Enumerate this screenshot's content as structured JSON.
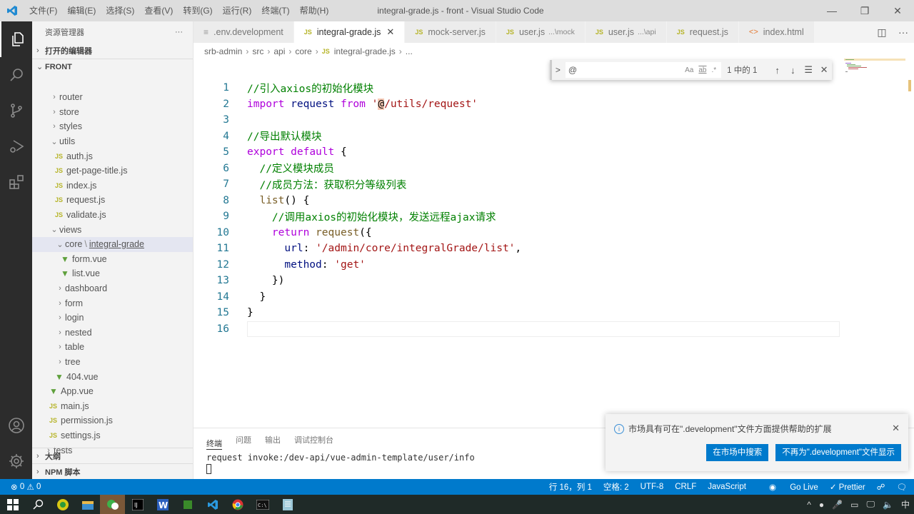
{
  "window": {
    "title": "integral-grade.js - front - Visual Studio Code",
    "menu": [
      "文件(F)",
      "编辑(E)",
      "选择(S)",
      "查看(V)",
      "转到(G)",
      "运行(R)",
      "终端(T)",
      "帮助(H)"
    ],
    "controls": {
      "minimize": "—",
      "maximize": "❐",
      "close": "✕"
    }
  },
  "activitybar": {
    "items": [
      {
        "name": "explorer",
        "icon": "files-icon",
        "active": true
      },
      {
        "name": "search",
        "icon": "search-icon"
      },
      {
        "name": "source-control",
        "icon": "source-control-icon"
      },
      {
        "name": "run-debug",
        "icon": "run-debug-icon"
      },
      {
        "name": "extensions",
        "icon": "extensions-icon"
      }
    ],
    "bottom": [
      {
        "name": "accounts",
        "icon": "account-icon"
      },
      {
        "name": "manage",
        "icon": "gear-icon"
      }
    ]
  },
  "sidebar": {
    "title": "资源管理器",
    "more": "···",
    "open_editors": "打开的编辑器",
    "folder": "FRONT",
    "tree": [
      {
        "label": "router",
        "type": "folder",
        "expanded": false,
        "depth": 2
      },
      {
        "label": "store",
        "type": "folder",
        "expanded": false,
        "depth": 2
      },
      {
        "label": "styles",
        "type": "folder",
        "expanded": false,
        "depth": 2
      },
      {
        "label": "utils",
        "type": "folder",
        "expanded": true,
        "depth": 2
      },
      {
        "label": "auth.js",
        "type": "js",
        "depth": 3
      },
      {
        "label": "get-page-title.js",
        "type": "js",
        "depth": 3
      },
      {
        "label": "index.js",
        "type": "js",
        "depth": 3
      },
      {
        "label": "request.js",
        "type": "js",
        "depth": 3
      },
      {
        "label": "validate.js",
        "type": "js",
        "depth": 3
      },
      {
        "label": "views",
        "type": "folder",
        "expanded": true,
        "depth": 2
      },
      {
        "label": "core",
        "label2": "integral-grade",
        "type": "folder",
        "expanded": true,
        "depth": 3,
        "selected": true
      },
      {
        "label": "form.vue",
        "type": "vue",
        "depth": 4
      },
      {
        "label": "list.vue",
        "type": "vue",
        "depth": 4
      },
      {
        "label": "dashboard",
        "type": "folder",
        "expanded": false,
        "depth": 3
      },
      {
        "label": "form",
        "type": "folder",
        "expanded": false,
        "depth": 3
      },
      {
        "label": "login",
        "type": "folder",
        "expanded": false,
        "depth": 3
      },
      {
        "label": "nested",
        "type": "folder",
        "expanded": false,
        "depth": 3
      },
      {
        "label": "table",
        "type": "folder",
        "expanded": false,
        "depth": 3
      },
      {
        "label": "tree",
        "type": "folder",
        "expanded": false,
        "depth": 3
      },
      {
        "label": "404.vue",
        "type": "vue",
        "depth": 3
      },
      {
        "label": "App.vue",
        "type": "vue",
        "depth": 2
      },
      {
        "label": "main.js",
        "type": "js",
        "depth": 2
      },
      {
        "label": "permission.js",
        "type": "js",
        "depth": 2
      },
      {
        "label": "settings.js",
        "type": "js",
        "depth": 2
      },
      {
        "label": "tests",
        "type": "folder",
        "expanded": false,
        "depth": 1
      }
    ],
    "outline": "大纲",
    "npm_scripts": "NPM 脚本"
  },
  "tabs": [
    {
      "label": ".env.development",
      "icon": "≡",
      "kind": "env"
    },
    {
      "label": "integral-grade.js",
      "icon": "JS",
      "kind": "js",
      "active": true,
      "close": "✕"
    },
    {
      "label": "mock-server.js",
      "icon": "JS",
      "kind": "js"
    },
    {
      "label": "user.js",
      "desc": "...\\mock",
      "icon": "JS",
      "kind": "js"
    },
    {
      "label": "user.js",
      "desc": "...\\api",
      "icon": "JS",
      "kind": "js"
    },
    {
      "label": "request.js",
      "icon": "JS",
      "kind": "js"
    },
    {
      "label": "index.html",
      "icon": "<>",
      "kind": "html"
    }
  ],
  "tab_actions": {
    "split": "◫",
    "more": "···"
  },
  "breadcrumb": [
    "srb-admin",
    "src",
    "api",
    "core",
    "integral-grade.js",
    "..."
  ],
  "find": {
    "toggle": ">",
    "value": "@",
    "match_case": "Aa",
    "whole_word": "ab",
    "regex": ".*",
    "count": "1 中的 1",
    "prev": "↑",
    "next": "↓",
    "selection": "☰",
    "close": "✕"
  },
  "code": {
    "current_line": 16,
    "lines": [
      [
        {
          "t": "//引入axios的初始化模块",
          "c": "com"
        }
      ],
      [
        {
          "t": "import",
          "c": "kw"
        },
        {
          "t": " request ",
          "c": "id"
        },
        {
          "t": "from",
          "c": "kw"
        },
        {
          "t": " '",
          "c": "str"
        },
        {
          "t": "@",
          "c": "find"
        },
        {
          "t": "/utils/request'",
          "c": "str"
        }
      ],
      [],
      [
        {
          "t": "//导出默认模块",
          "c": "com"
        }
      ],
      [
        {
          "t": "export",
          "c": "kw"
        },
        {
          "t": " ",
          "c": ""
        },
        {
          "t": "default",
          "c": "kw"
        },
        {
          "t": " {",
          "c": ""
        }
      ],
      [
        {
          "t": "  //定义模块成员",
          "c": "com"
        }
      ],
      [
        {
          "t": "  //成员方法：获取积分等级列表",
          "c": "com"
        }
      ],
      [
        {
          "t": "  ",
          "c": ""
        },
        {
          "t": "list",
          "c": "fn"
        },
        {
          "t": "() {",
          "c": ""
        }
      ],
      [
        {
          "t": "    //调用axios的初始化模块，发送远程ajax请求",
          "c": "com"
        }
      ],
      [
        {
          "t": "    ",
          "c": ""
        },
        {
          "t": "return",
          "c": "kw"
        },
        {
          "t": " ",
          "c": ""
        },
        {
          "t": "request",
          "c": "fn"
        },
        {
          "t": "({",
          "c": ""
        }
      ],
      [
        {
          "t": "      ",
          "c": ""
        },
        {
          "t": "url",
          "c": "id"
        },
        {
          "t": ": ",
          "c": ""
        },
        {
          "t": "'/admin/core/integralGrade/list'",
          "c": "str"
        },
        {
          "t": ",",
          "c": ""
        }
      ],
      [
        {
          "t": "      ",
          "c": ""
        },
        {
          "t": "method",
          "c": "id"
        },
        {
          "t": ": ",
          "c": ""
        },
        {
          "t": "'get'",
          "c": "str"
        }
      ],
      [
        {
          "t": "    })",
          "c": ""
        }
      ],
      [
        {
          "t": "  }",
          "c": ""
        }
      ],
      [
        {
          "t": "}",
          "c": ""
        }
      ],
      []
    ]
  },
  "panel": {
    "tabs": [
      "终端",
      "问题",
      "输出",
      "调试控制台"
    ],
    "active_tab": 0,
    "terminal_lines": [
      "request invoke:/dev-api/vue-admin-template/user/info"
    ]
  },
  "notification": {
    "message": "市场具有可在\".development\"文件方面提供帮助的扩展",
    "buttons": [
      "在市场中搜索",
      "不再为\".development\"文件显示"
    ],
    "close": "✕"
  },
  "statusbar": {
    "errors": "0",
    "warnings": "0",
    "position": "行 16，列 1",
    "spaces": "空格: 2",
    "encoding": "UTF-8",
    "eol": "CRLF",
    "language": "JavaScript",
    "golive": "Go Live",
    "prettier": "✓ Prettier",
    "color": "#007acc"
  },
  "taskbar": {
    "apps": [
      "start",
      "search",
      "app-green",
      "file-explorer",
      "wechat",
      "intellij",
      "word",
      "app-green2",
      "vscode",
      "chrome",
      "cmd",
      "notepad"
    ],
    "active": "wechat",
    "tray": {
      "chevron": "^",
      "ime": "中"
    }
  }
}
